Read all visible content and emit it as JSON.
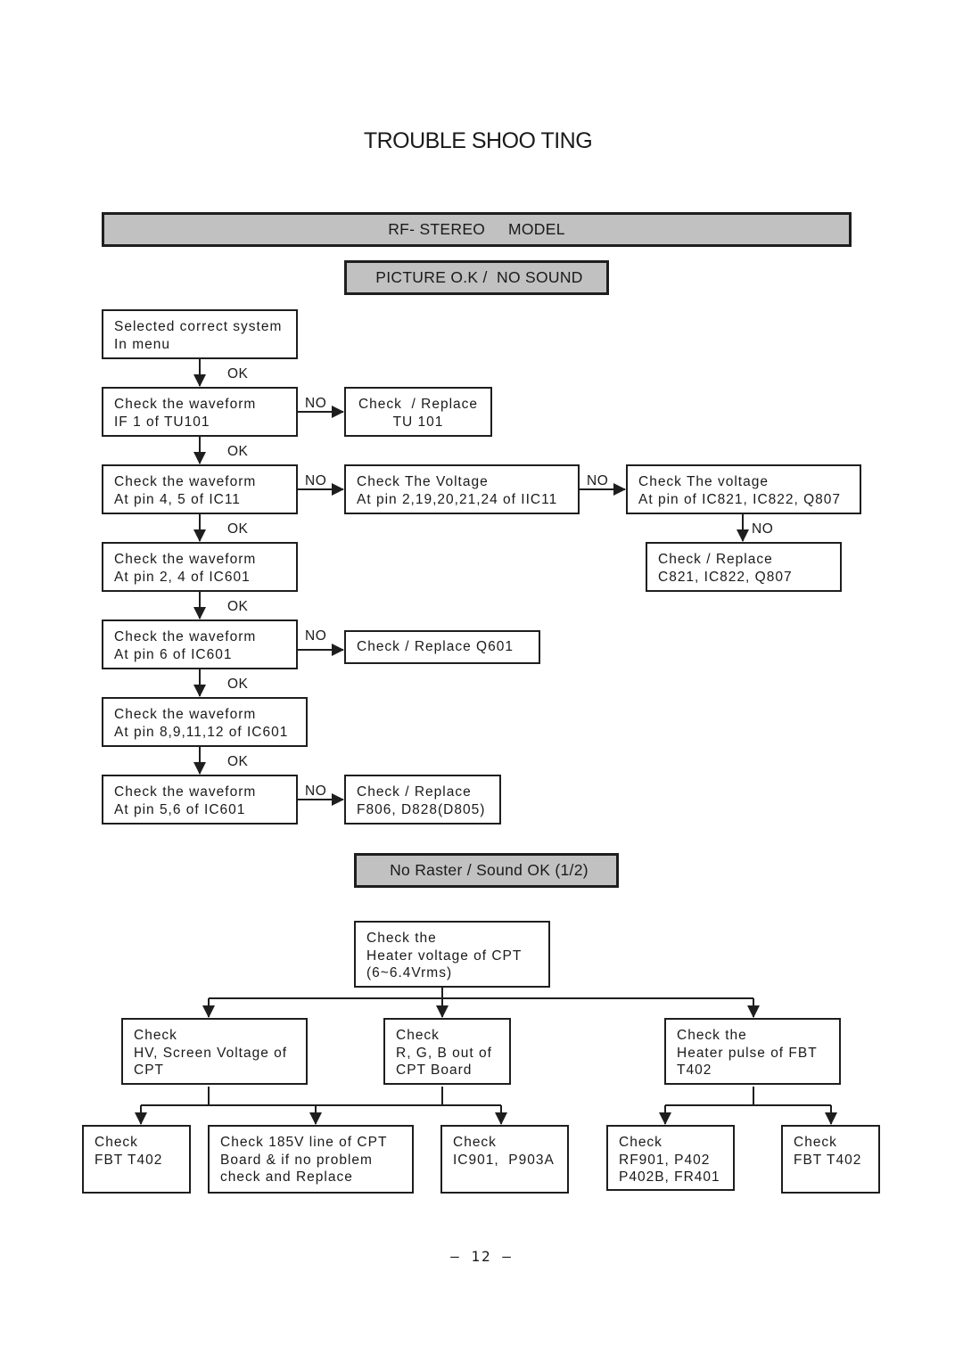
{
  "title": "TROUBLE SHOO TING",
  "model_header": "RF- STEREO     MODEL",
  "section1": {
    "header": "PICTURE O.K /  NO SOUND",
    "main": [
      {
        "lines": [
          "Selected correct system",
          "In menu"
        ]
      },
      {
        "lines": [
          "Check the waveform",
          "IF 1 of TU101"
        ]
      },
      {
        "lines": [
          "Check the waveform",
          "At pin 4, 5 of IC11"
        ]
      },
      {
        "lines": [
          "Check the waveform",
          "At pin 2, 4 of IC601"
        ]
      },
      {
        "lines": [
          "Check the waveform",
          "At pin 6 of IC601"
        ]
      },
      {
        "lines": [
          "Check the waveform",
          "At pin 8,9,11,12 of IC601"
        ]
      },
      {
        "lines": [
          "Check the waveform",
          "At pin 5,6 of IC601"
        ]
      }
    ],
    "side": [
      {
        "lines": [
          "Check  / Replace",
          "TU 101"
        ]
      },
      {
        "lines": [
          "Check The Voltage",
          "At pin 2,19,20,21,24 of IIC11"
        ]
      },
      {
        "lines": [
          "Check The voltage",
          "At pin of IC821, IC822, Q807"
        ]
      },
      {
        "lines": [
          "Check / Replace",
          "C821, IC822, Q807"
        ]
      },
      {
        "lines": [
          "Check / Replace Q601"
        ]
      },
      {
        "lines": [
          "Check / Replace",
          "F806, D828(D805)"
        ]
      }
    ],
    "ok_label": "OK",
    "no_label": "NO"
  },
  "section2": {
    "header": "No Raster / Sound OK (1/2)",
    "root": {
      "lines": [
        "Check the",
        "Heater voltage of CPT",
        "(6~6.4Vrms)"
      ]
    },
    "level2": [
      {
        "lines": [
          "Check",
          "HV, Screen Voltage of",
          "CPT"
        ]
      },
      {
        "lines": [
          "Check",
          "R, G, B out of",
          "CPT Board"
        ]
      },
      {
        "lines": [
          "Check the",
          "Heater pulse of FBT",
          "T402"
        ]
      }
    ],
    "level3": [
      {
        "lines": [
          "Check",
          "FBT T402"
        ]
      },
      {
        "lines": [
          "Check 185V line of CPT",
          "Board & if no problem",
          "check and Replace"
        ]
      },
      {
        "lines": [
          "Check",
          "IC901,  P903A"
        ]
      },
      {
        "lines": [
          "Check",
          "RF901, P402",
          "P402B, FR401"
        ]
      },
      {
        "lines": [
          "Check",
          "FBT T402"
        ]
      }
    ]
  },
  "page_number": "– 12 –"
}
